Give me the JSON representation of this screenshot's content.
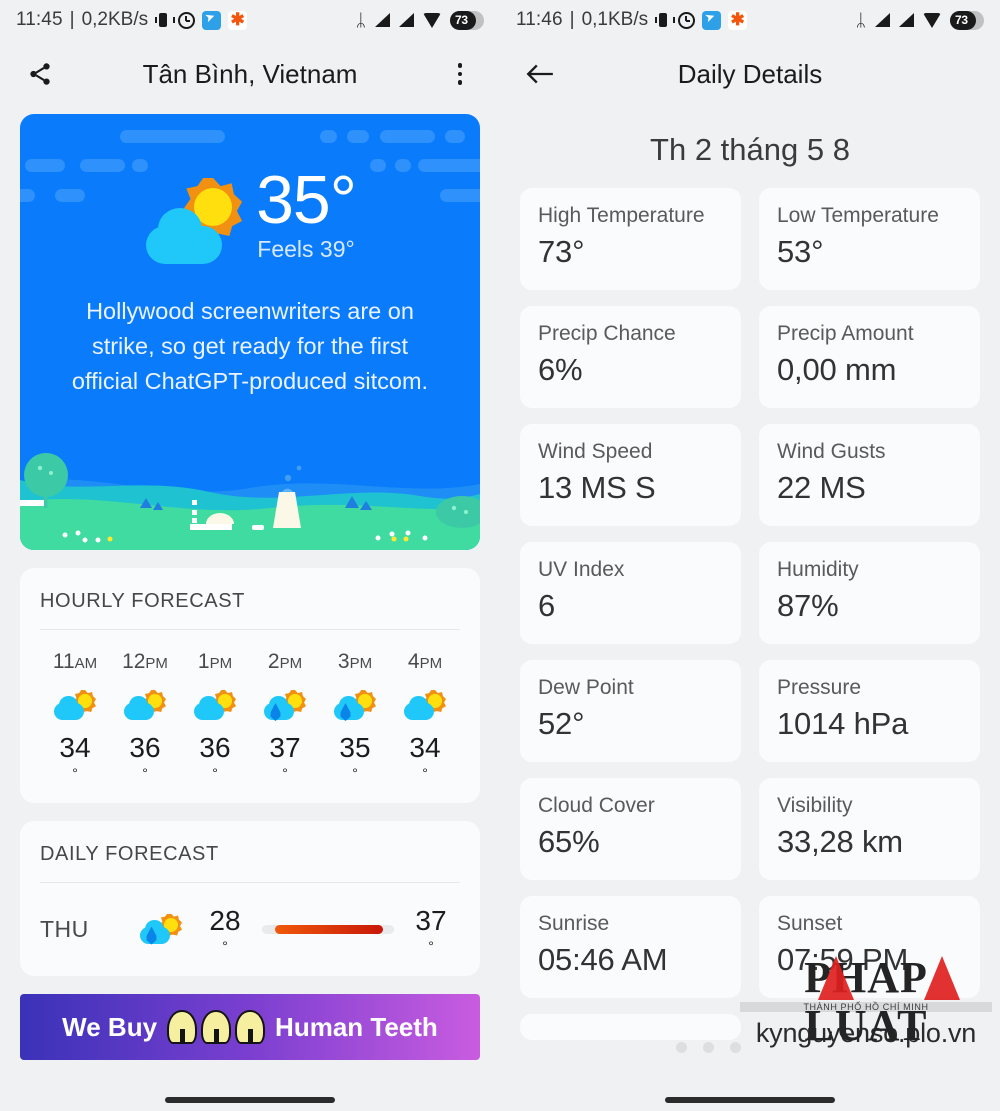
{
  "left": {
    "status": {
      "time": "11:45",
      "separator": "|",
      "netspeed": "0,2KB/s",
      "icons": [
        "vibrate-icon",
        "alarm-icon",
        "telegram-icon",
        "asterisk-icon"
      ],
      "bluetooth": "ᛦ",
      "battery_level": "73"
    },
    "appbar": {
      "share_icon": "share-icon",
      "title": "Tân Bình, Vietnam",
      "overflow_icon": "more-vertical-icon"
    },
    "hero": {
      "condition_icon": "partly-cloudy-icon",
      "temperature": "35°",
      "feels_like": "Feels 39°",
      "blurb": "Hollywood screenwriters are on strike, so get ready for the first official ChatGPT-produced sitcom.",
      "bg_color": "#0a7bfb"
    },
    "hourly": {
      "title": "HOURLY FORECAST",
      "items": [
        {
          "hour": "11",
          "ampm": "AM",
          "icon": "partly-cloudy-icon",
          "temp": "34",
          "deg": "°"
        },
        {
          "hour": "12",
          "ampm": "PM",
          "icon": "partly-cloudy-icon",
          "temp": "36",
          "deg": "°"
        },
        {
          "hour": "1",
          "ampm": "PM",
          "icon": "partly-cloudy-icon",
          "temp": "36",
          "deg": "°"
        },
        {
          "hour": "2",
          "ampm": "PM",
          "icon": "rain-partly-cloudy-icon",
          "temp": "37",
          "deg": "°"
        },
        {
          "hour": "3",
          "ampm": "PM",
          "icon": "rain-partly-cloudy-icon",
          "temp": "35",
          "deg": "°"
        },
        {
          "hour": "4",
          "ampm": "PM",
          "icon": "partly-cloudy-icon",
          "temp": "34",
          "deg": "°"
        }
      ]
    },
    "daily": {
      "title": "DAILY FORECAST",
      "rows": [
        {
          "day": "THU",
          "icon": "rain-partly-cloudy-icon",
          "low": "28",
          "high": "37",
          "deg": "°",
          "bar_from": "#f0590a",
          "bar_to": "#c8180a"
        }
      ]
    },
    "ad": {
      "text_left": "We Buy",
      "text_right": "Human Teeth",
      "icon": "tooth-icon",
      "tooth_count": 3
    }
  },
  "right": {
    "status": {
      "time": "11:46",
      "separator": "|",
      "netspeed": "0,1KB/s",
      "bluetooth": "ᛦ",
      "battery_level": "73"
    },
    "appbar": {
      "back_icon": "arrow-left-icon",
      "title": "Daily Details"
    },
    "date_heading": "Th 2 tháng 5 8",
    "details": [
      {
        "label": "High Temperature",
        "value": "73°"
      },
      {
        "label": "Low Temperature",
        "value": "53°"
      },
      {
        "label": "Precip Chance",
        "value": "6%"
      },
      {
        "label": "Precip Amount",
        "value": "0,00 mm"
      },
      {
        "label": "Wind Speed",
        "value": "13 MS S"
      },
      {
        "label": "Wind Gusts",
        "value": "22 MS"
      },
      {
        "label": "UV Index",
        "value": "6"
      },
      {
        "label": "Humidity",
        "value": "87%"
      },
      {
        "label": "Dew Point",
        "value": "52°"
      },
      {
        "label": "Pressure",
        "value": "1014 hPa"
      },
      {
        "label": "Cloud Cover",
        "value": "65%"
      },
      {
        "label": "Visibility",
        "value": "33,28 km"
      },
      {
        "label": "Sunrise",
        "value": "05:46 AM"
      },
      {
        "label": "Sunset",
        "value": "07:59 PM"
      }
    ],
    "page_dots": 3,
    "watermark": {
      "brand": "PHAP LUAT",
      "sub": "THÀNH PHỐ HỒ CHÍ MINH",
      "url": "kynguyenso.plo.vn"
    }
  }
}
